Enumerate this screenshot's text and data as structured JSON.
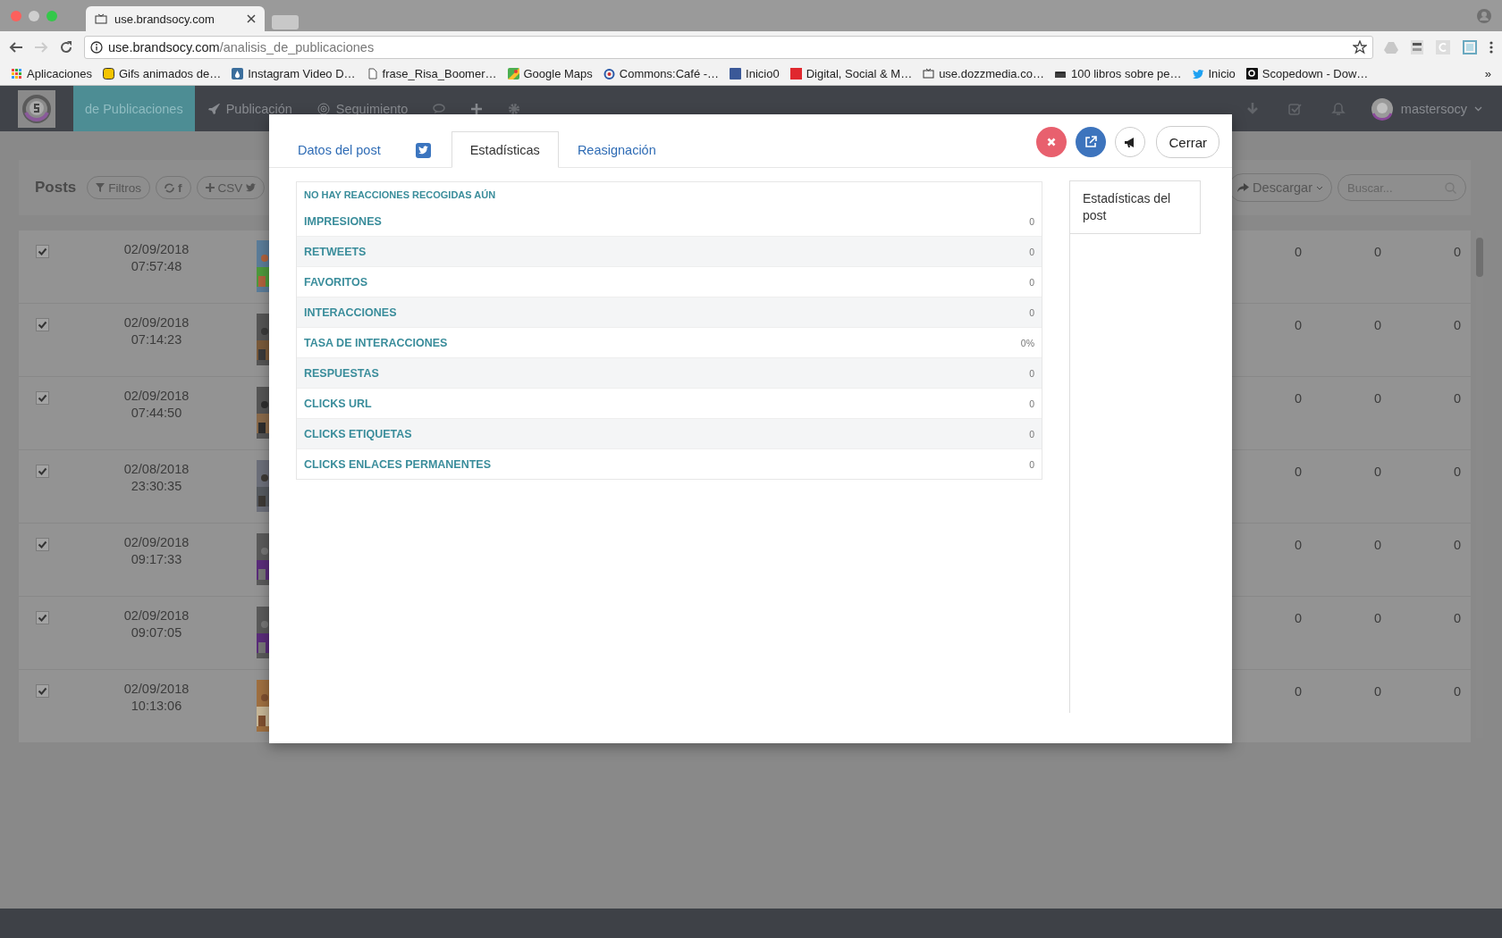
{
  "browser": {
    "tab_title": "use.brandsocy.com",
    "url_host": "use.brandsocy.com",
    "url_path": "/analisis_de_publicaciones",
    "more": "»",
    "bookmarks": [
      {
        "label": "Aplicaciones"
      },
      {
        "label": "Gifs animados de…"
      },
      {
        "label": "Instagram Video D…"
      },
      {
        "label": "frase_Risa_Boomer…"
      },
      {
        "label": "Google Maps"
      },
      {
        "label": "Commons:Café -…"
      },
      {
        "label": "Inicio0"
      },
      {
        "label": "Digital, Social & M…"
      },
      {
        "label": "use.dozzmedia.co…"
      },
      {
        "label": "100 libros sobre pe…"
      },
      {
        "label": "Inicio"
      },
      {
        "label": "Scopedown - Dow…"
      }
    ]
  },
  "nav": {
    "items": [
      {
        "label": "de Publicaciones",
        "selected": true
      },
      {
        "label": "Publicación",
        "selected": false
      },
      {
        "label": "Seguimiento",
        "selected": false
      }
    ],
    "user": "mastersocy"
  },
  "toolbar": {
    "title": "Posts",
    "filter": "Filtros",
    "sync": "f",
    "csv": "CSV",
    "download": "Descargar",
    "search_placeholder": "Buscar..."
  },
  "posts": [
    {
      "checked": true,
      "date": "02/09/2018",
      "time": "07:57:48",
      "metrics": [
        "0",
        "0",
        "0"
      ]
    },
    {
      "checked": true,
      "date": "02/09/2018",
      "time": "07:14:23",
      "metrics": [
        "0",
        "0",
        "0"
      ]
    },
    {
      "checked": true,
      "date": "02/09/2018",
      "time": "07:44:50",
      "metrics": [
        "0",
        "0",
        "0"
      ]
    },
    {
      "checked": true,
      "date": "02/08/2018",
      "time": "23:30:35",
      "metrics": [
        "0",
        "0",
        "0"
      ]
    },
    {
      "checked": true,
      "date": "02/09/2018",
      "time": "09:17:33",
      "metrics": [
        "0",
        "0",
        "0"
      ]
    },
    {
      "checked": true,
      "date": "02/09/2018",
      "time": "09:07:05",
      "metrics": [
        "0",
        "0",
        "0"
      ]
    },
    {
      "checked": true,
      "date": "02/09/2018",
      "time": "10:13:06",
      "metrics": [
        "0",
        "0",
        "0"
      ]
    }
  ],
  "modal": {
    "tabs": [
      {
        "kind": "text",
        "label": "Datos del post",
        "selected": false
      },
      {
        "kind": "icon",
        "selected": false
      },
      {
        "kind": "text",
        "label": "Estadísticas",
        "selected": true
      },
      {
        "kind": "text",
        "label": "Reasignación",
        "selected": false
      }
    ],
    "close_label": "Cerrar",
    "stats": {
      "heading": "NO HAY REACCIONES RECOGIDAS AÚN",
      "rows": [
        {
          "label": "IMPRESIONES",
          "value": "0"
        },
        {
          "label": "RETWEETS",
          "value": "0"
        },
        {
          "label": "FAVORITOS",
          "value": "0"
        },
        {
          "label": "INTERACCIONES",
          "value": "0"
        },
        {
          "label": "TASA DE INTERACCIONES",
          "value": "0%"
        },
        {
          "label": "RESPUESTAS",
          "value": "0"
        },
        {
          "label": "CLICKS URL",
          "value": "0"
        },
        {
          "label": "CLICKS ETIQUETAS",
          "value": "0"
        },
        {
          "label": "CLICKS ENLACES PERMANENTES",
          "value": "0"
        }
      ]
    },
    "side_tab": {
      "label": "Estadísticas del post",
      "selected": true
    }
  }
}
